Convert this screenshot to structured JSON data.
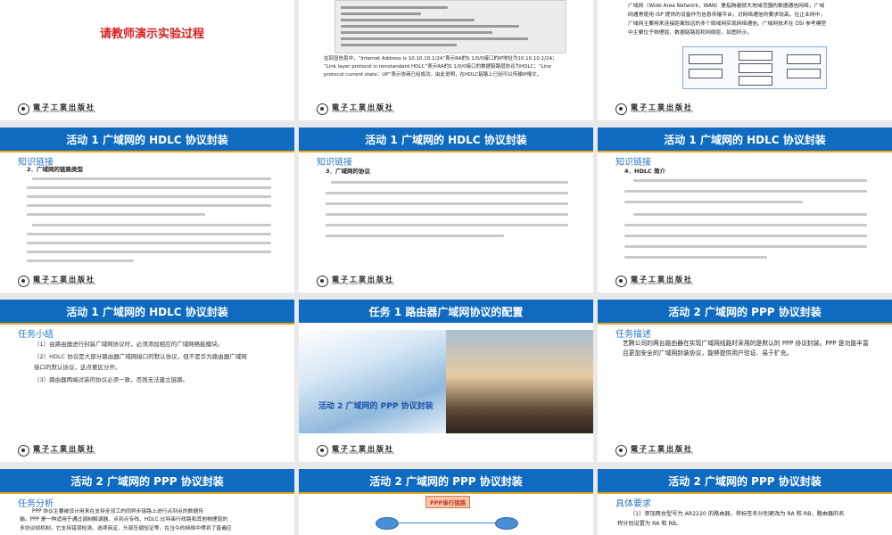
{
  "slides": {
    "s00": {
      "demo_text": "请教师演示实验过程"
    },
    "s01": {
      "caption_line1": "在回显信息中，“Internet Address is 10.10.10.1/24”表示RA的S 1/0/0接口的IP地址为10.10.10.1/24；",
      "caption_line2": "“Link layer protocol is nonstandard HDLC”表示RA的S 1/0/0接口的数据链路层协议为HDLC；“Line",
      "caption_line3": "protocol current state：UP”表示协商已经成功，由此说明，在HDLC链路上已经可以传输IP报文。"
    },
    "s02": {
      "para_line1": "广域网（Wide Area Network，WAN）是指跨越很大地域范围的数据通信网络，广域",
      "para_line2": "网通常使用 ISP 提供的设备作为信息传输平台，对网络通信的要求较高。在企业网中，",
      "para_line3": "广域网主要用来连接距离较远的多个局域网实现网络通信。广域网技术在 OSI 参考模型",
      "para_line4": "中主要位于物理层、数据链路层和网络层，如图所示。"
    },
    "s10": {
      "title": "活动 1    广域网的 HDLC 协议封装",
      "sub": "知识链接",
      "head": "2．广域网的链路类型"
    },
    "s11": {
      "title": "活动 1    广域网的 HDLC 协议封装",
      "sub": "知识链接",
      "head": "3．广域网的协议"
    },
    "s12": {
      "title": "活动 1    广域网的 HDLC 协议封装",
      "sub": "知识链接",
      "head": "4．HDLC 简介"
    },
    "s20": {
      "title": "活动 1    广域网的 HDLC 协议封装",
      "sub": "任务小结",
      "items": [
        "（1）由路由器进行封装广域网协议时，必须添加相应的广域网络能模块。",
        "（2）HDLC 协议是大部分路由器广域网接口的默认协议，但不是华为路由器广域网",
        "接口的默认协议，这点要区分开。",
        "（3）路由器两端对装的协议必须一致，否则无法建立链路。"
      ]
    },
    "s21": {
      "title": "任务 1    路由器广域网协议的配置",
      "photo_label": "活动 2    广域网的 PPP 协议封装"
    },
    "s22": {
      "title": "活动 2    广域网的 PPP 协议封装",
      "sub": "任务描述",
      "text": "艺腾公司的两台路由器在实现广域网线路时采用的是默认的 PPP 协议封装。PPP 是功能丰富且更加安全的广域网封装协议，能够提供用户验证、易于扩充。"
    },
    "s30": {
      "title": "活动 2    广域网的 PPP 协议封装",
      "sub": "任务分析",
      "line1": "PPP 协议主要被设计用来在支持全双工的同异步链路上进行点到点的数据传",
      "line2": "输。PPP 是一种适用于通过调制解调器、点到点专线、HDLC 比特串行线路和其他物理层的",
      "line3": "多协议帧机制，它支持错误检测、选项商定、头部压缩验证等，在当今的网络中得到了普遍应"
    },
    "s31": {
      "title": "活动 2    广域网的 PPP 协议封装",
      "tag": "PPP串行链路"
    },
    "s32": {
      "title": "活动 2    广域网的 PPP 协议封装",
      "sub": "具体要求",
      "line1": "（1）添加两台型号为 AR2220 的路由器，将标签名分别更改为 RA 和 RB，路由器的名",
      "line2": "称分别设置为 RA 和 RB。"
    }
  },
  "publisher": {
    "zh": "電子工業出版社",
    "en": "Publishing House of Electronics Industry"
  },
  "colors": {
    "bar": "#0e6bc0",
    "accent": "#f2a516",
    "sub": "#2a74c2",
    "red": "#d61f1f"
  }
}
